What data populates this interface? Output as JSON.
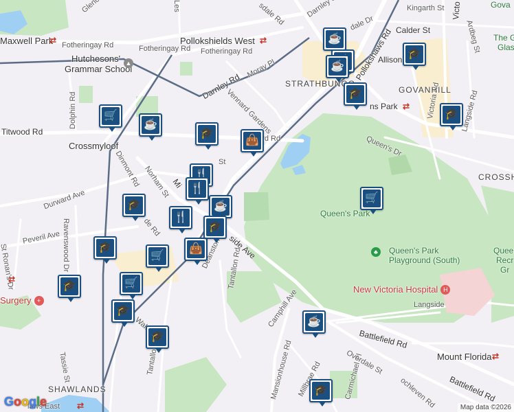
{
  "map": {
    "attribution": "Map data ©2026",
    "logo": [
      "G",
      "o",
      "o",
      "g",
      "l",
      "e"
    ],
    "colors": {
      "background": "#f2f0f4",
      "park": "#c8e6c1",
      "water": "#9fd0f3",
      "road": "#ffffff",
      "rail": "#5a6c86",
      "marker": "#1b4f80",
      "hospital": "#e05a5a"
    }
  },
  "labels": {
    "street": [
      "Glencairn Dr",
      "Les",
      "sdale Rd",
      "Darnley St",
      "dale Dr",
      "Kingarth St",
      "Victo",
      "Calder St",
      "Ardbeg St",
      "Fotheringay Rd",
      "Fotheringay Rd",
      "Fotheringay Rd",
      "Moray Pl",
      "Darnley Rd",
      "Dolphin Rd",
      "Titwood Rd",
      "Vennard Gardens",
      "Queen's Dr",
      "ns Park",
      "Langside Rd",
      "Victoria Rd",
      "Allison",
      "Dinmont Rd",
      "Norham St",
      "Mi",
      "St",
      "Durward Ave",
      "Ravenswood Dr",
      "Peveril Ave",
      "St Ronan's Dr",
      "de Rd",
      "side Ave",
      "Deanston Dr",
      "Tantallon Rd",
      "Walt",
      "Tassie St",
      "Tantallon Rd",
      "Camphill Ave",
      "Mansionhouse Rd",
      "Millbrae Rd",
      "Carmichael Pl",
      "Overdale St",
      "Battlefield Rd",
      "Battlefield Rd",
      "Langside",
      "ochleven Rd",
      "Pollokshaws Rd",
      "Vennard Rd"
    ],
    "place": [
      "Maxwell Park",
      "Pollokshields West",
      "Crossmyloof",
      "STRATHBUNGO",
      "GOVANHILL",
      "CROSSH",
      "SHAWLANDS",
      "Mount Florida",
      "Queen's Park",
      "Gova",
      "The G",
      "Glas",
      "Queen",
      "Recr",
      "Gr"
    ],
    "school": [
      "Hutchesons'",
      "Grammar School"
    ],
    "green_poi": [
      "Queen's Park",
      "Playground (South)"
    ],
    "hospital": "New Victoria Hospital",
    "surgery": "Surgery",
    "rail_partial": "laws East"
  },
  "markers": [
    {
      "type": "cafe-icon"
    },
    {
      "type": "cafe-icon"
    },
    {
      "type": "cafe-icon"
    },
    {
      "type": "school-icon"
    },
    {
      "type": "school-icon"
    },
    {
      "type": "school-icon"
    },
    {
      "type": "shopping-cart-icon"
    },
    {
      "type": "cafe-icon"
    },
    {
      "type": "school-icon"
    },
    {
      "type": "shopping-bag-icon"
    },
    {
      "type": "restaurant-icon"
    },
    {
      "type": "restaurant-icon"
    },
    {
      "type": "cafe-icon"
    },
    {
      "type": "school-icon"
    },
    {
      "type": "restaurant-icon"
    },
    {
      "type": "shopping-bag-icon"
    },
    {
      "type": "school-icon"
    },
    {
      "type": "shopping-cart-icon"
    },
    {
      "type": "shopping-cart-icon"
    },
    {
      "type": "school-icon"
    },
    {
      "type": "school-icon"
    },
    {
      "type": "school-icon"
    },
    {
      "type": "cafe-icon"
    },
    {
      "type": "school-icon"
    },
    {
      "type": "shopping-cart-icon"
    }
  ]
}
